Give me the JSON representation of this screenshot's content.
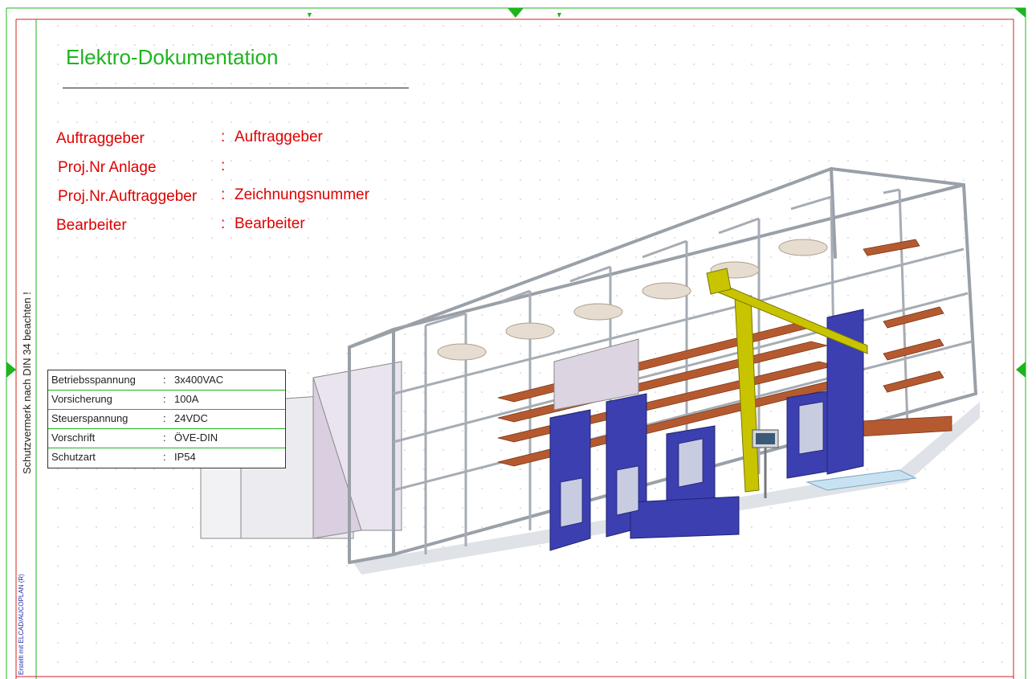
{
  "document": {
    "title": "Elektro-Dokumentation",
    "protection_note": "Schutzvermerk nach DIN 34 beachten !",
    "created_with": "Erstellt mit ELCAD/AUCOPLAN (R)"
  },
  "project_info": [
    {
      "label": "Auftraggeber",
      "value": "Auftraggeber"
    },
    {
      "label": "Proj.Nr Anlage",
      "value": ""
    },
    {
      "label": "Proj.Nr.Auftraggeber",
      "value": "Zeichnungsnummer"
    },
    {
      "label": "Bearbeiter",
      "value": "Bearbeiter"
    }
  ],
  "specs": [
    {
      "key": "Betriebsspannung",
      "value": "3x400VAC"
    },
    {
      "key": "Vorsicherung",
      "value": "100A"
    },
    {
      "key": "Steuerspannung",
      "value": "24VDC"
    },
    {
      "key": "Vorschrift",
      "value": "ÖVE-DIN"
    },
    {
      "key": "Schutzart",
      "value": "IP54"
    }
  ],
  "colors": {
    "frame_green": "#1eb51e",
    "frame_red": "#d42020",
    "text_red": "#e00000",
    "machine_blue": "#3b3fb0",
    "frame_gray": "#9aa0a8",
    "product_brown": "#b55a30",
    "crane_yellow": "#c9c400"
  },
  "image": {
    "subject": "machine-3d-illustration"
  }
}
